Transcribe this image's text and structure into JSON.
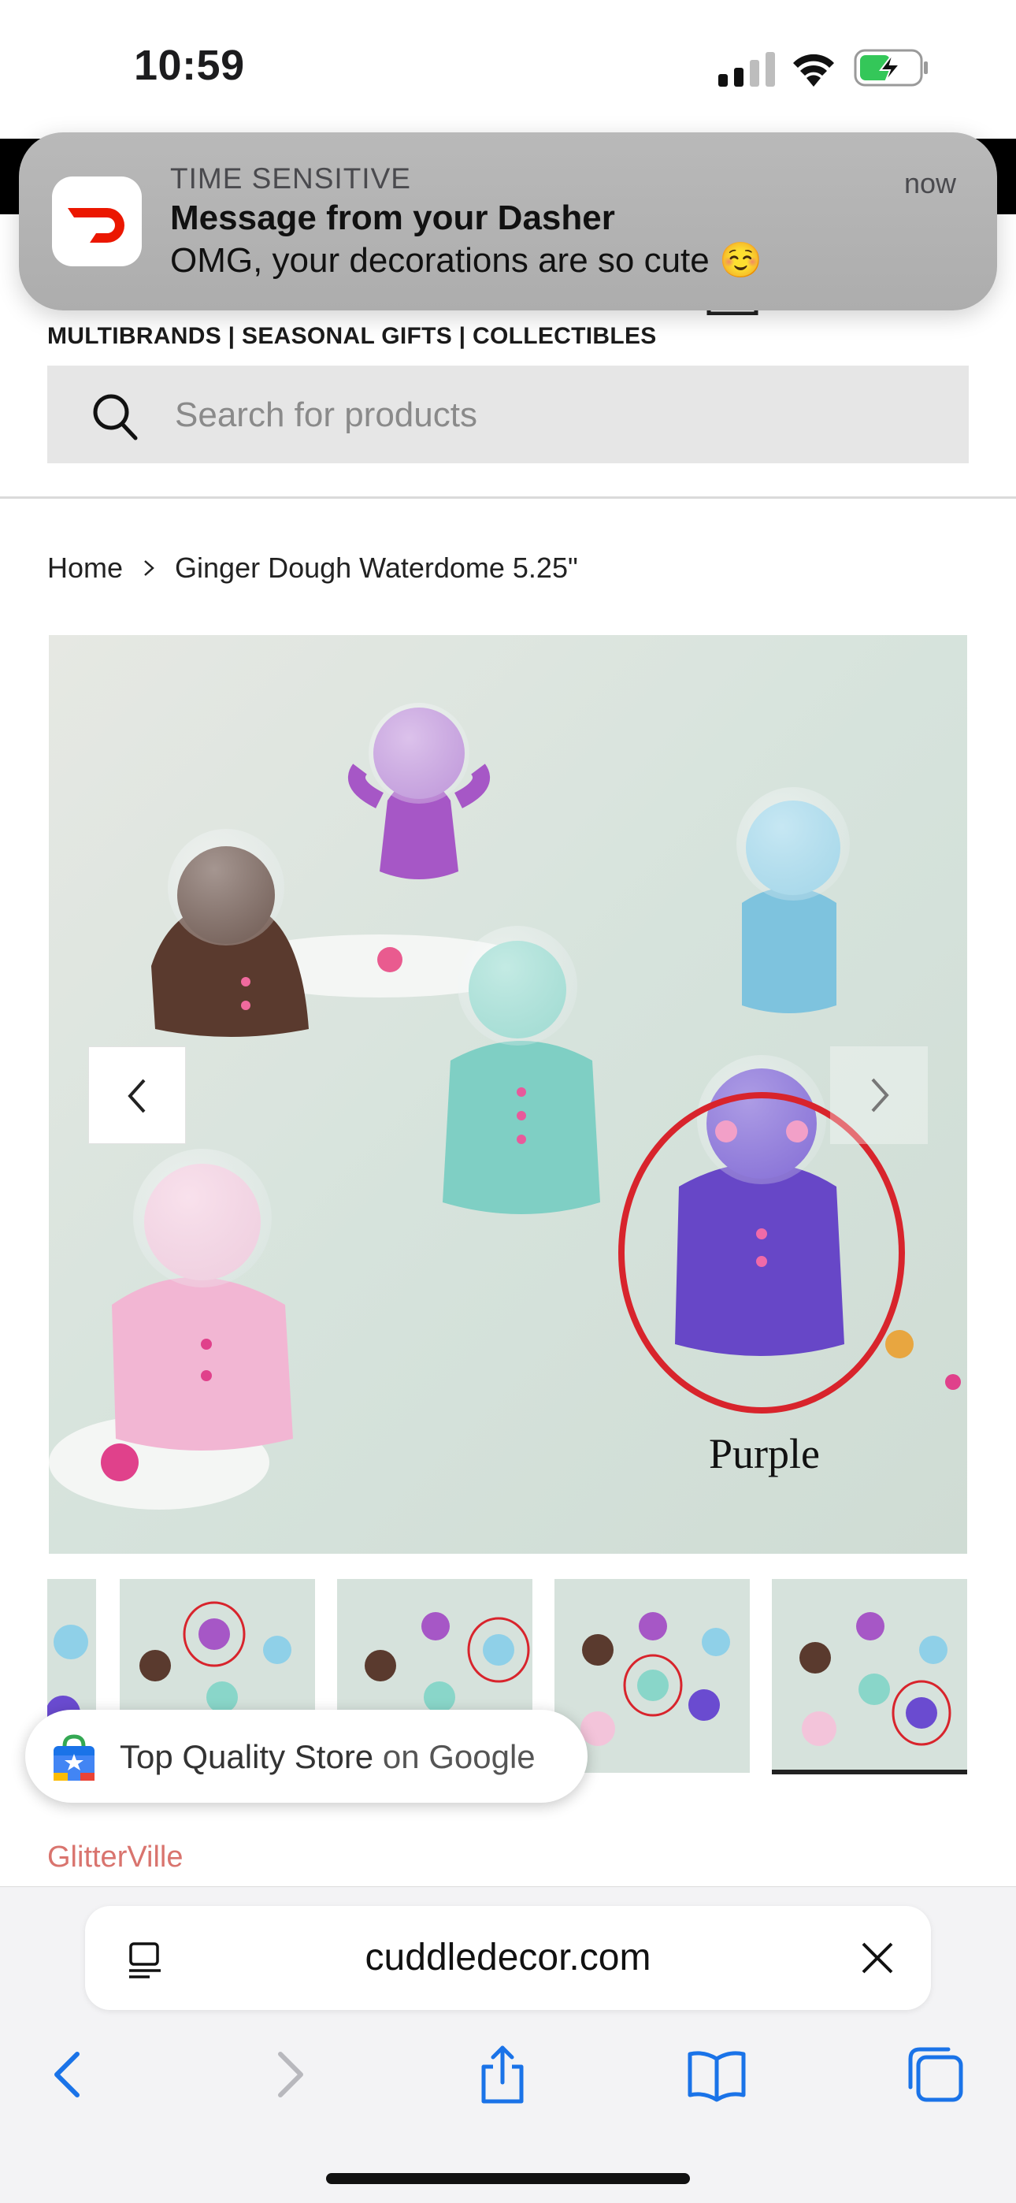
{
  "status_bar": {
    "time": "10:59"
  },
  "notification": {
    "category": "TIME SENSITIVE",
    "time": "now",
    "title": "Message from your Dasher",
    "body": "OMG, your decorations are so cute ☺️",
    "app_icon": "doordash-icon",
    "brand_color": "#eb1700"
  },
  "header": {
    "tagline": "MULTIBRANDS | SEASONAL GIFTS | COLLECTIBLES"
  },
  "search": {
    "placeholder": "Search for products"
  },
  "breadcrumb": {
    "home": "Home",
    "current": "Ginger Dough Waterdome 5.25\""
  },
  "product": {
    "image_caption": "Purple",
    "thumbnail_count": 5,
    "active_thumbnail": 5,
    "brand": "GlitterVille",
    "brand_color": "#d9746e"
  },
  "google_badge": {
    "text_main": "Top Quality Store",
    "text_suffix": " on Google"
  },
  "safari": {
    "url": "cuddledecor.com",
    "accent_color": "#1a73e8"
  }
}
